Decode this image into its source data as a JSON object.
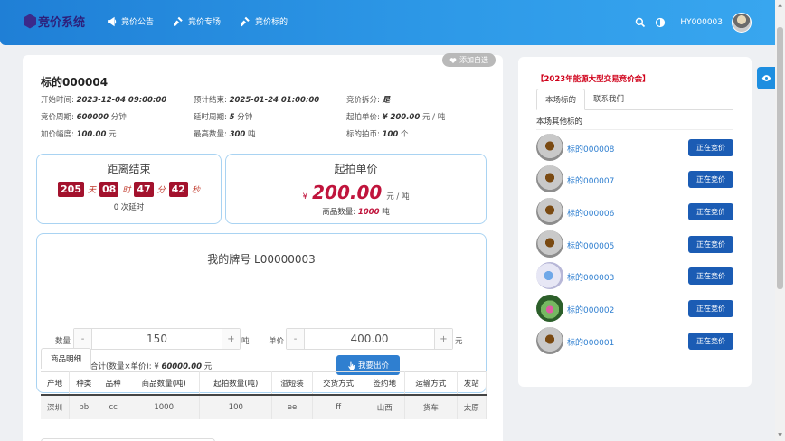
{
  "header": {
    "logo_text": "竞价系统",
    "nav": [
      {
        "label": "竞价公告",
        "icon": "megaphone-icon"
      },
      {
        "label": "竞价专场",
        "icon": "gavel-icon"
      },
      {
        "label": "竞价标的",
        "icon": "gavel-icon"
      }
    ],
    "username": "HY000003"
  },
  "lot": {
    "favorite_label": "添加自选",
    "title": "标的000004",
    "info": [
      {
        "label": "开始时间:",
        "value": "2023-12-04 09:00:00"
      },
      {
        "label": "预计结束:",
        "value": "2025-01-24 01:00:00"
      },
      {
        "label": "竞价拆分:",
        "value": "是"
      },
      {
        "label": "竞价周期:",
        "value": "600000",
        "suffix": "分钟"
      },
      {
        "label": "延时周期:",
        "value": "5",
        "suffix": "分钟"
      },
      {
        "label": "起拍单价:",
        "value": "¥ 200.00",
        "suffix": "元 / 吨"
      },
      {
        "label": "加价幅度:",
        "value": "100.00",
        "suffix": "元"
      },
      {
        "label": "最高数量:",
        "value": "300",
        "suffix": "吨"
      },
      {
        "label": "标的拍币:",
        "value": "100",
        "suffix": "个"
      }
    ]
  },
  "timer": {
    "title": "距离结束",
    "days": "205",
    "days_unit": "天",
    "hours": "08",
    "hours_unit": "时",
    "minutes": "47",
    "minutes_unit": "分",
    "seconds": "42",
    "seconds_unit": "秒",
    "delay_text": "0 次延时"
  },
  "start_price": {
    "title": "起拍单价",
    "currency": "¥",
    "amount": "200.00",
    "unit": "元 / 吨",
    "qty_label": "商品数量:",
    "qty_value": "1000",
    "qty_unit": "吨"
  },
  "bid": {
    "title": "我的牌号 L00000003",
    "qty_label": "数量",
    "qty_value": "150",
    "qty_unit": "吨",
    "price_label": "单价",
    "price_value": "400.00",
    "price_unit": "元",
    "minus": "-",
    "plus": "+",
    "total_label": "合计(数量×单价): ¥",
    "total_value": "60000.00",
    "total_unit": "元",
    "submit_label": "我要出价"
  },
  "detail": {
    "tab_label": "商品明细",
    "columns": [
      "产地",
      "种类",
      "品种",
      "商品数量(吨)",
      "起拍数量(吨)",
      "溢短装",
      "交货方式",
      "签约地",
      "运输方式",
      "发站"
    ],
    "row": [
      "深圳",
      "bb",
      "cc",
      "1000",
      "100",
      "ee",
      "ff",
      "山西",
      "货车",
      "太原"
    ]
  },
  "sidebar": {
    "title": "【2023年能源大型交易竞价会】",
    "tabs": [
      "本场标的",
      "联系我们"
    ],
    "subtitle": "本场其他标的",
    "items": [
      {
        "name": "标的000008",
        "status": "正在竞价"
      },
      {
        "name": "标的000007",
        "status": "正在竞价"
      },
      {
        "name": "标的000006",
        "status": "正在竞价"
      },
      {
        "name": "标的000005",
        "status": "正在竞价"
      },
      {
        "name": "标的000003",
        "status": "正在竞价"
      },
      {
        "name": "标的000002",
        "status": "正在竞价"
      },
      {
        "name": "标的000001",
        "status": "正在竞价"
      }
    ]
  },
  "colors": {
    "header_blue": "#2e9ae8",
    "countdown_red": "#a3122d",
    "price_red": "#c0143c",
    "status_blue": "#1b5cb4",
    "button_blue": "#2f7fd0"
  }
}
